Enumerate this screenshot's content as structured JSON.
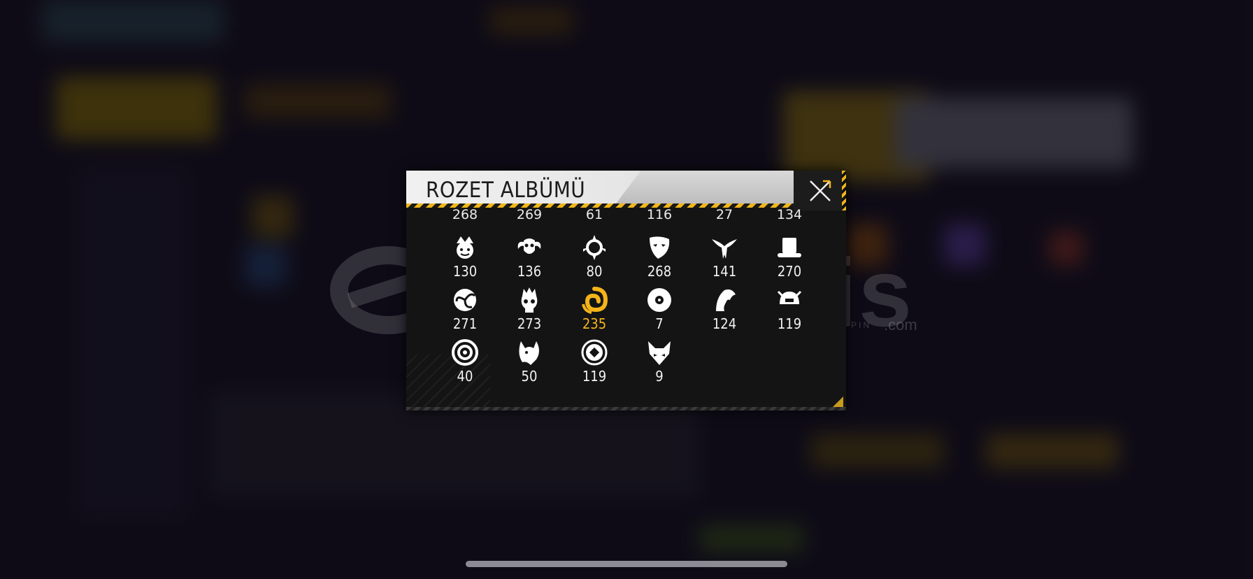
{
  "modal": {
    "title": "ROZET ALBÜMÜ",
    "top_row_counts": [
      "268",
      "269",
      "61",
      "116",
      "27",
      "134"
    ],
    "badges": [
      {
        "icon": "jester-badge-icon",
        "count": "130"
      },
      {
        "icon": "ram-skull-badge-icon",
        "count": "136"
      },
      {
        "icon": "ornament-badge-icon",
        "count": "80"
      },
      {
        "icon": "mask-badge-icon",
        "count": "268"
      },
      {
        "icon": "dragon-badge-icon",
        "count": "141"
      },
      {
        "icon": "top-hat-badge-icon",
        "count": "270"
      },
      {
        "icon": "swirl-badge-icon",
        "count": "271"
      },
      {
        "icon": "flaming-skull-badge-icon",
        "count": "273"
      },
      {
        "icon": "golden-spiral-badge-icon",
        "count": "235",
        "selected": true
      },
      {
        "icon": "vinyl-badge-icon",
        "count": "7"
      },
      {
        "icon": "horse-badge-icon",
        "count": "124"
      },
      {
        "icon": "helmet-badge-icon",
        "count": "119"
      },
      {
        "icon": "target-badge-icon",
        "count": "40"
      },
      {
        "icon": "wolf-badge-icon",
        "count": "50"
      },
      {
        "icon": "emblem-badge-icon",
        "count": "119"
      },
      {
        "icon": "fox-badge-icon",
        "count": "9"
      }
    ],
    "selected_color": "#f4b41a"
  },
  "watermark": {
    "brand": "itemsatis",
    "tagline": "HESAP / SKIN / ITEM / E-PIN",
    "domain": ".com"
  }
}
